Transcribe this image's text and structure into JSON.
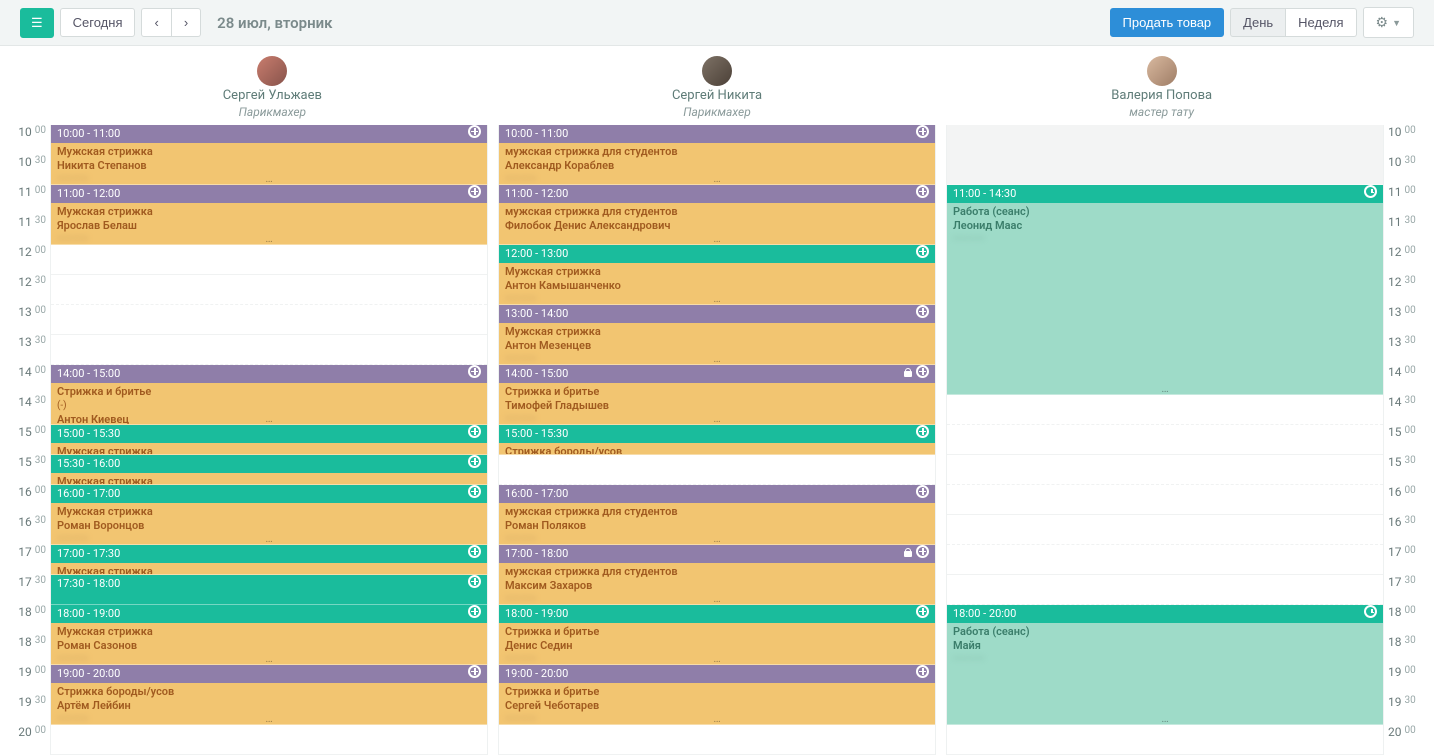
{
  "toolbar": {
    "today": "Сегодня",
    "date": "28 июл, вторник",
    "sell": "Продать товар",
    "day": "День",
    "week": "Неделя"
  },
  "staff": [
    {
      "name": "Сергей Ульжаев",
      "role": "Парикмахер"
    },
    {
      "name": "Сергей Никита",
      "role": "Парикмахер"
    },
    {
      "name": "Валерия Попова",
      "role": "мастер тату"
    }
  ],
  "time_start": 10,
  "time_end": 20,
  "columns": [
    {
      "staff_index": 0,
      "events": [
        {
          "start": "10:00",
          "end": "11:00",
          "time_label": "10:00 - 11:00",
          "head": "purple",
          "body": "orange",
          "icon": "plus",
          "service": "Мужская стрижка",
          "client": "Никита Степанов",
          "blur": "————"
        },
        {
          "start": "11:00",
          "end": "12:00",
          "time_label": "11:00 - 12:00",
          "head": "purple",
          "body": "orange",
          "icon": "plus",
          "service": "Мужская стрижка",
          "client": "Ярослав Белаш",
          "blur": "————"
        },
        {
          "start": "14:00",
          "end": "15:00",
          "time_label": "14:00 - 15:00",
          "head": "purple",
          "body": "orange",
          "icon": "plus",
          "service": "Стрижка и бритье",
          "extra": "(-)",
          "client": "Антон Киевец"
        },
        {
          "start": "15:00",
          "end": "15:30",
          "time_label": "15:00 - 15:30",
          "head": "teal",
          "body": "orange",
          "icon": "plus",
          "service": "Мужская стрижка"
        },
        {
          "start": "15:30",
          "end": "16:00",
          "time_label": "15:30 - 16:00",
          "head": "teal",
          "body": "orange",
          "icon": "plus",
          "service": "Мужская стрижка"
        },
        {
          "start": "16:00",
          "end": "17:00",
          "time_label": "16:00 - 17:00",
          "head": "teal",
          "body": "orange",
          "icon": "plus",
          "service": "Мужская стрижка",
          "client": "Роман Воронцов",
          "blur": "————"
        },
        {
          "start": "17:00",
          "end": "17:30",
          "time_label": "17:00 - 17:30",
          "head": "teal",
          "body": "orange",
          "icon": "plus",
          "service": "Мужская стрижка"
        },
        {
          "start": "17:30",
          "end": "18:00",
          "time_label": "17:30 - 18:00",
          "head": "teal",
          "body": "teal",
          "icon": "plus"
        },
        {
          "start": "18:00",
          "end": "19:00",
          "time_label": "18:00 - 19:00",
          "head": "teal",
          "body": "orange",
          "icon": "plus",
          "service": "Мужская стрижка",
          "client": "Роман Сазонов",
          "blur": "————"
        },
        {
          "start": "19:00",
          "end": "20:00",
          "time_label": "19:00 - 20:00",
          "head": "purple",
          "body": "orange",
          "icon": "plus",
          "service": "Стрижка бороды/усов",
          "client": "Артём Лейбин",
          "blur": "————"
        }
      ]
    },
    {
      "staff_index": 1,
      "events": [
        {
          "start": "10:00",
          "end": "11:00",
          "time_label": "10:00 - 11:00",
          "head": "purple",
          "body": "orange",
          "icon": "plus",
          "service": "мужская стрижка для студентов",
          "client": "Александр Кораблев",
          "blur": "————"
        },
        {
          "start": "11:00",
          "end": "12:00",
          "time_label": "11:00 - 12:00",
          "head": "purple",
          "body": "orange",
          "icon": "plus",
          "service": "мужская стрижка для студентов",
          "client": "Филобок Денис Александрович"
        },
        {
          "start": "12:00",
          "end": "13:00",
          "time_label": "12:00 - 13:00",
          "head": "teal",
          "body": "orange",
          "icon": "plus",
          "service": "Мужская стрижка",
          "client": "Антон Камышанченко",
          "blur": "————"
        },
        {
          "start": "13:00",
          "end": "14:00",
          "time_label": "13:00 - 14:00",
          "head": "purple",
          "body": "orange",
          "icon": "plus",
          "service": "Мужская стрижка",
          "client": "Антон Мезенцев",
          "blur": "————"
        },
        {
          "start": "14:00",
          "end": "15:00",
          "time_label": "14:00 - 15:00",
          "head": "purple",
          "body": "orange",
          "icon": "plus",
          "lock": true,
          "service": "Стрижка и бритье",
          "client": "Тимофей Гладышев",
          "blur": "————"
        },
        {
          "start": "15:00",
          "end": "15:30",
          "time_label": "15:00 - 15:30",
          "head": "teal",
          "body": "orange",
          "icon": "plus",
          "service": "Стрижка бороды/усов"
        },
        {
          "start": "16:00",
          "end": "17:00",
          "time_label": "16:00 - 17:00",
          "head": "purple",
          "body": "orange",
          "icon": "plus",
          "service": "мужская стрижка для студентов",
          "client": "Роман Поляков",
          "blur": "————"
        },
        {
          "start": "17:00",
          "end": "18:00",
          "time_label": "17:00 - 18:00",
          "head": "purple",
          "body": "orange",
          "icon": "plus",
          "lock": true,
          "service": "мужская стрижка для студентов",
          "client": "Максим Захаров",
          "blur": "————"
        },
        {
          "start": "18:00",
          "end": "19:00",
          "time_label": "18:00 - 19:00",
          "head": "teal",
          "body": "orange",
          "icon": "plus",
          "service": "Стрижка и бритье",
          "client": "Денис Седин",
          "blur": "————"
        },
        {
          "start": "19:00",
          "end": "20:00",
          "time_label": "19:00 - 20:00",
          "head": "purple",
          "body": "orange",
          "icon": "plus",
          "service": "Стрижка и бритье",
          "client": "Сергей Чеботарев",
          "blur": "————"
        }
      ]
    },
    {
      "staff_index": 2,
      "off_ranges": [
        {
          "start": "10:00",
          "end": "11:00"
        }
      ],
      "events": [
        {
          "start": "11:00",
          "end": "14:30",
          "time_label": "11:00 - 14:30",
          "head": "teal",
          "body": "mint",
          "icon": "clock",
          "service": "Работа (сеанс)",
          "client": "Леонид Маас",
          "blur": "————"
        },
        {
          "start": "18:00",
          "end": "20:00",
          "time_label": "18:00 - 20:00",
          "head": "teal",
          "body": "mint",
          "icon": "clock",
          "service": "Работа (сеанс)",
          "client": "Майя",
          "blur": "————"
        }
      ]
    }
  ]
}
